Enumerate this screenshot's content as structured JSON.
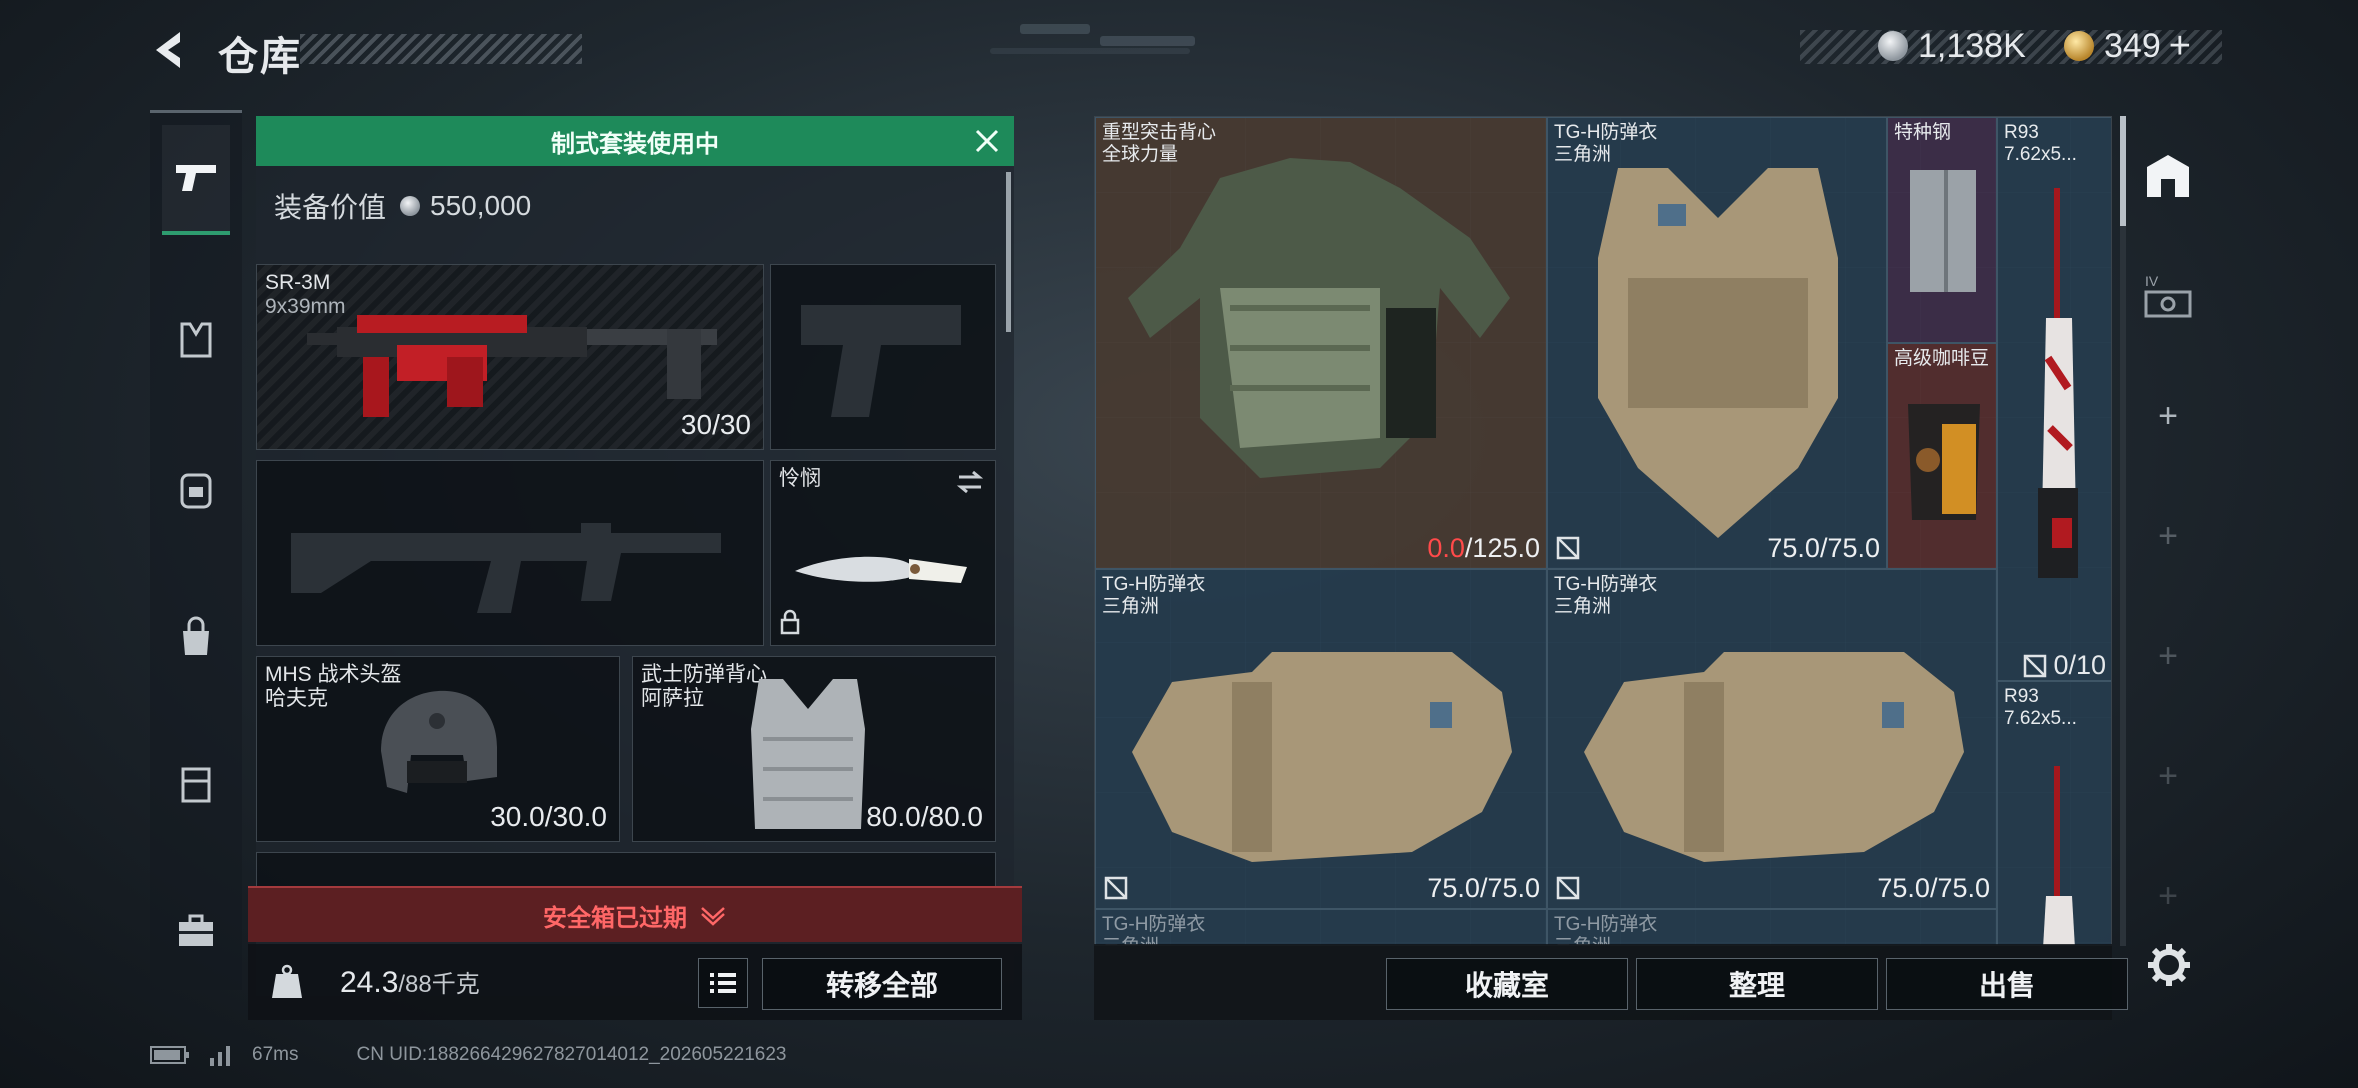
{
  "header": {
    "title": "仓库"
  },
  "currency": {
    "coins": "1,138K",
    "bonds": "349",
    "bonds_plus": "+"
  },
  "loadout": {
    "banner": "制式套装使用中",
    "value_label": "装备价值",
    "value": "550,000",
    "slots": {
      "primary": {
        "name": "SR-3M",
        "ammo": "9x39mm",
        "durability": "30/30"
      },
      "melee": {
        "name": "怜悯"
      },
      "helmet": {
        "name": "MHS 战术头盔",
        "sub": "哈夫克",
        "durability": "30.0/30.0"
      },
      "armor": {
        "name": "武士防弹背心",
        "sub": "阿萨拉",
        "durability": "80.0/80.0"
      }
    },
    "expired_text": "安全箱已过期",
    "weight": "24.3",
    "weight_cap": "/88千克",
    "transfer_all": "转移全部"
  },
  "storage": {
    "items": [
      {
        "name": "重型突击背心",
        "sub": "全球力量",
        "dur_current": "0.0",
        "dur_max": "/125.0"
      },
      {
        "name": "TG-H防弹衣",
        "sub": "三角洲",
        "durability": "75.0/75.0"
      },
      {
        "name": "特种钢"
      },
      {
        "name": "高级咖啡豆"
      },
      {
        "name": "R93",
        "sub": "7.62x5...",
        "count": "0/10"
      },
      {
        "name": "TG-H防弹衣",
        "sub": "三角洲",
        "durability": "75.0/75.0"
      },
      {
        "name": "TG-H防弹衣",
        "sub": "三角洲",
        "durability": "75.0/75.0"
      },
      {
        "name": "R93",
        "sub": "7.62x5..."
      },
      {
        "name": "TG-H防弹衣",
        "sub": "三角洲"
      },
      {
        "name": "TG-H防弹衣",
        "sub": "三角洲"
      }
    ],
    "buttons": {
      "collection": "收藏室",
      "organize": "整理",
      "sell": "出售"
    },
    "side_tabs": {
      "tab2_label": "IV"
    }
  },
  "status": {
    "ping": "67ms",
    "uid": "CN UID:188266429627827014012_202605221623"
  },
  "colors": {
    "accent_green": "#1e8a5a",
    "expired_red": "#ff6767",
    "damaged_red": "#ff4a4a"
  },
  "icons": [
    "back-arrow-icon",
    "silver-coin-icon",
    "gold-coin-icon",
    "pistol-icon",
    "armor-vest-icon",
    "backpack-icon",
    "bag-icon",
    "chest-rig-icon",
    "toolbox-icon",
    "close-icon",
    "swap-icon",
    "lock-icon",
    "not-insured-icon",
    "chevron-down-icon",
    "list-icon",
    "weight-kg-icon",
    "storage-home-icon",
    "plus-icon",
    "settings-gear-icon",
    "battery-icon",
    "signal-icon"
  ]
}
